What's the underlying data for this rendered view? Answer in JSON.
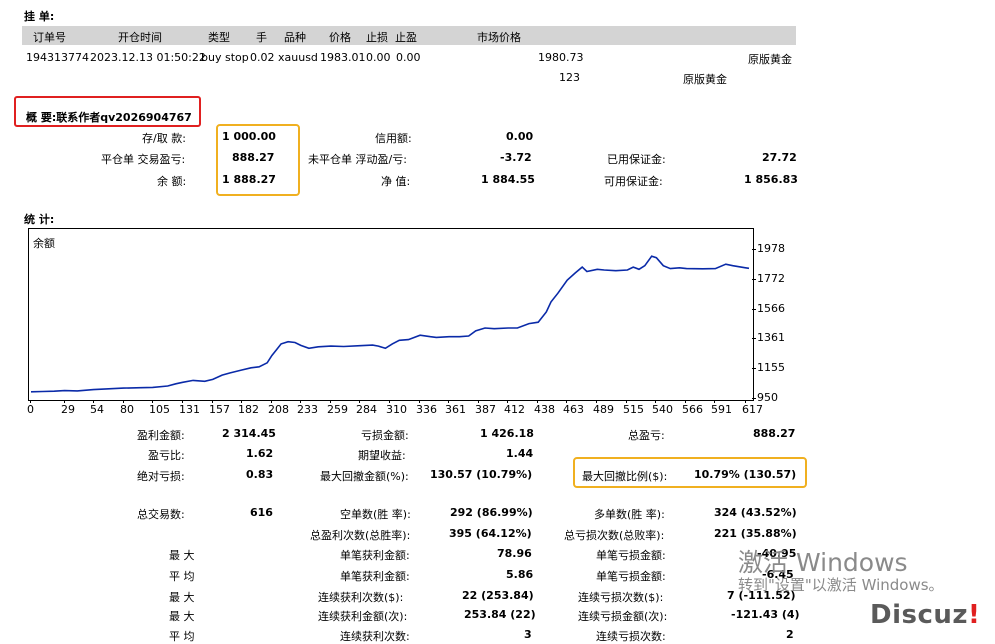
{
  "pending": {
    "section_title": "挂 单:",
    "columns": [
      "订单号",
      "开仓时间",
      "类型",
      "手",
      "品种",
      "价格",
      "止损",
      "止盈",
      "市场价格"
    ],
    "rows": [
      {
        "ticket": "194313774",
        "time": "2023.12.13 01:50:22",
        "type": "buy stop",
        "lots": "0.02",
        "symbol": "xauusd",
        "price": "1983.01",
        "sl": "0.00",
        "tp": "0.00",
        "market": "1980.73",
        "comment": "原版黄金"
      },
      {
        "market": "123",
        "comment": "原版黄金"
      }
    ]
  },
  "summary": {
    "title": "概 要:联系作者qv2026904767",
    "deposit_label": "存/取 款:",
    "deposit_value": "1 000.00",
    "closed_label": "平仓单 交易盈亏:",
    "closed_value": "888.27",
    "balance_label": "余 额:",
    "balance_value": "1 888.27",
    "credit_label": "信用额:",
    "credit_value": "0.00",
    "floating_label": "未平仓单 浮动盈/亏:",
    "floating_value": "-3.72",
    "equity_label": "净 值:",
    "equity_value": "1 884.55",
    "margin_label": "已用保证金:",
    "margin_value": "27.72",
    "free_margin_label": "可用保证金:",
    "free_margin_value": "1 856.83"
  },
  "stats_title": "统 计:",
  "chart_data": {
    "type": "line",
    "series": [
      {
        "name": "余额"
      }
    ],
    "y_ticks": [
      "1978",
      "1772",
      "1566",
      "1361",
      "1155",
      "950"
    ],
    "ylim": [
      950,
      1978
    ],
    "x_ticks": [
      "0",
      "29",
      "54",
      "80",
      "105",
      "131",
      "157",
      "182",
      "208",
      "233",
      "259",
      "284",
      "310",
      "336",
      "361",
      "387",
      "412",
      "438",
      "463",
      "489",
      "515",
      "540",
      "566",
      "591",
      "617"
    ],
    "xlim": [
      0,
      620
    ],
    "line_color": "#0a2aa8",
    "points": [
      [
        0,
        1000
      ],
      [
        10,
        1002
      ],
      [
        20,
        1004
      ],
      [
        29,
        1008
      ],
      [
        40,
        1006
      ],
      [
        54,
        1015
      ],
      [
        65,
        1020
      ],
      [
        80,
        1025
      ],
      [
        95,
        1028
      ],
      [
        105,
        1030
      ],
      [
        118,
        1040
      ],
      [
        125,
        1055
      ],
      [
        131,
        1065
      ],
      [
        140,
        1078
      ],
      [
        150,
        1072
      ],
      [
        157,
        1085
      ],
      [
        165,
        1115
      ],
      [
        172,
        1130
      ],
      [
        182,
        1150
      ],
      [
        190,
        1165
      ],
      [
        197,
        1172
      ],
      [
        204,
        1200
      ],
      [
        208,
        1250
      ],
      [
        212,
        1290
      ],
      [
        216,
        1330
      ],
      [
        222,
        1345
      ],
      [
        228,
        1340
      ],
      [
        233,
        1320
      ],
      [
        240,
        1300
      ],
      [
        248,
        1310
      ],
      [
        259,
        1315
      ],
      [
        270,
        1312
      ],
      [
        284,
        1318
      ],
      [
        295,
        1322
      ],
      [
        300,
        1315
      ],
      [
        306,
        1300
      ],
      [
        312,
        1330
      ],
      [
        318,
        1355
      ],
      [
        326,
        1360
      ],
      [
        336,
        1390
      ],
      [
        345,
        1380
      ],
      [
        350,
        1375
      ],
      [
        361,
        1380
      ],
      [
        370,
        1380
      ],
      [
        378,
        1385
      ],
      [
        384,
        1420
      ],
      [
        392,
        1440
      ],
      [
        400,
        1435
      ],
      [
        412,
        1440
      ],
      [
        420,
        1440
      ],
      [
        430,
        1470
      ],
      [
        438,
        1480
      ],
      [
        445,
        1550
      ],
      [
        449,
        1620
      ],
      [
        455,
        1680
      ],
      [
        463,
        1770
      ],
      [
        470,
        1820
      ],
      [
        476,
        1860
      ],
      [
        480,
        1830
      ],
      [
        489,
        1845
      ],
      [
        495,
        1840
      ],
      [
        505,
        1835
      ],
      [
        515,
        1840
      ],
      [
        520,
        1860
      ],
      [
        525,
        1845
      ],
      [
        530,
        1870
      ],
      [
        536,
        1935
      ],
      [
        540,
        1925
      ],
      [
        546,
        1870
      ],
      [
        552,
        1850
      ],
      [
        560,
        1855
      ],
      [
        566,
        1850
      ],
      [
        580,
        1848
      ],
      [
        591,
        1850
      ],
      [
        600,
        1880
      ],
      [
        606,
        1870
      ],
      [
        617,
        1855
      ],
      [
        620,
        1852
      ]
    ]
  },
  "stats": {
    "profit_label": "盈利金额:",
    "profit_value": "2 314.45",
    "loss_label": "亏损金额:",
    "loss_value": "1 426.18",
    "net_label": "总盈亏:",
    "net_value": "888.27",
    "ratio_label": "盈亏比:",
    "ratio_value": "1.62",
    "expected_label": "期望收益:",
    "expected_value": "1.44",
    "abs_dd_label": "绝对亏损:",
    "abs_dd_value": "0.83",
    "max_dd_label": "最大回撤金额(%):",
    "max_dd_value": "130.57 (10.79%)",
    "max_dd_pct_label": "最大回撤比例($):",
    "max_dd_pct_value": "10.79% (130.57)",
    "total_trades_label": "总交易数:",
    "total_trades_value": "616",
    "short_label": "空单数(胜 率):",
    "short_value": "292 (86.99%)",
    "long_label": "多单数(胜 率):",
    "long_value": "324 (43.52%)",
    "win_label": "总盈利次数(总胜率):",
    "win_value": "395 (64.12%)",
    "losscnt_label": "总亏损次数(总败率):",
    "losscnt_value": "221 (35.88%)",
    "max1": "最 大",
    "best_label": "单笔获利金额:",
    "best_value": "78.96",
    "worst_label": "单笔亏损金额:",
    "worst_value": "-40.95",
    "avg1": "平 均",
    "avg_win_label": "单笔获利金额:",
    "avg_win_value": "5.86",
    "avg_loss_label": "单笔亏损金额:",
    "avg_loss_value": "-6.45",
    "max2": "最 大",
    "cw_cnt_label": "连续获利次数($):",
    "cw_cnt_value": "22 (253.84)",
    "cl_cnt_label": "连续亏损次数($):",
    "cl_cnt_value": "7 (-111.52)",
    "max3": "最 大",
    "cw_amt_label": "连续获利金额(次):",
    "cw_amt_value": "253.84 (22)",
    "cl_amt_label": "连续亏损金额(次):",
    "cl_amt_value": "-121.43 (4)",
    "avg2": "平 均",
    "avg_cw_label": "连续获利次数:",
    "avg_cw_value": "3",
    "avg_cl_label": "连续亏损次数:",
    "avg_cl_value": "2"
  },
  "overlay": {
    "activate_title": "激活 Windows",
    "activate_sub": "转到\"设置\"以激活 Windows。",
    "brand_text": "Discuz",
    "brand_mark": "!"
  }
}
